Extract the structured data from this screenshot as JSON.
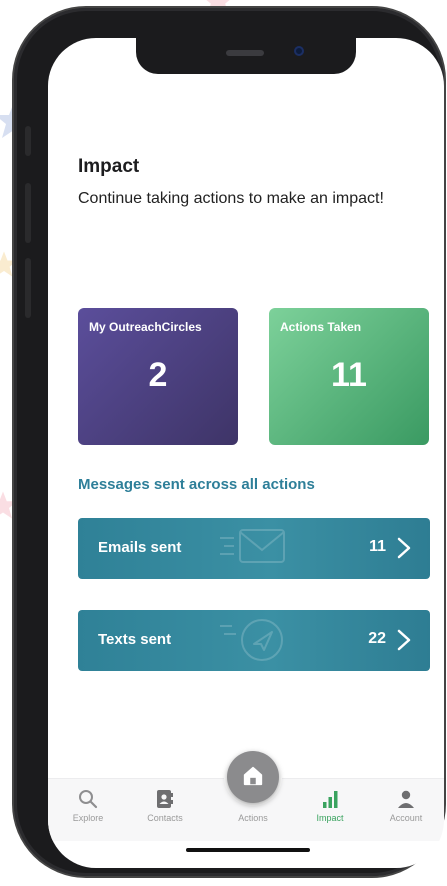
{
  "page": {
    "title": "Impact",
    "subtitle": "Continue taking actions to make an impact!"
  },
  "cards": [
    {
      "label": "My OutreachCircles",
      "value": "2"
    },
    {
      "label": "Actions Taken",
      "value": "11"
    }
  ],
  "messages": {
    "heading": "Messages sent across all actions",
    "rows": [
      {
        "label": "Emails sent",
        "value": "11"
      },
      {
        "label": "Texts sent",
        "value": "22"
      }
    ]
  },
  "tabbar": {
    "items": [
      {
        "label": "Explore",
        "icon": "search-icon"
      },
      {
        "label": "Contacts",
        "icon": "contacts-icon"
      },
      {
        "label": "Actions",
        "icon": "home-icon"
      },
      {
        "label": "Impact",
        "icon": "bar-chart-icon",
        "active": true
      },
      {
        "label": "Account",
        "icon": "person-icon"
      }
    ]
  },
  "colors": {
    "accent": "#2e7f99",
    "impact_green": "#3aa35f",
    "card_purple": "#4f4585",
    "card_green": "#5cb97e",
    "row_teal": "#338497"
  }
}
